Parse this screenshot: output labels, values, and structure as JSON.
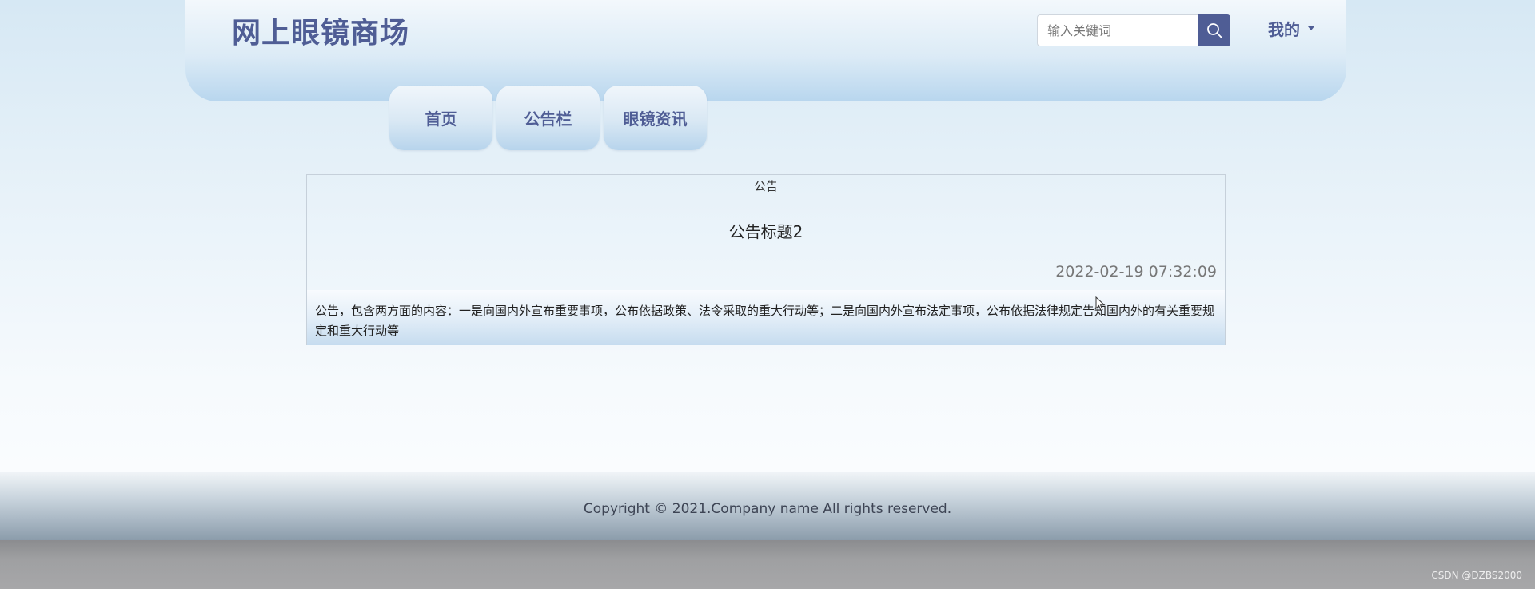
{
  "header": {
    "site_title": "网上眼镜商场",
    "search_placeholder": "输入关键词",
    "user_menu_label": "我的"
  },
  "nav": {
    "tabs": [
      {
        "label": "首页"
      },
      {
        "label": "公告栏"
      },
      {
        "label": "眼镜资讯"
      }
    ]
  },
  "notice": {
    "section_label": "公告",
    "title": "公告标题2",
    "date": "2022-02-19 07:32:09",
    "content": "公告，包含两方面的内容：一是向国内外宣布重要事项，公布依据政策、法令采取的重大行动等；二是向国内外宣布法定事项，公布依据法律规定告知国内外的有关重要规定和重大行动等"
  },
  "footer": {
    "copyright": "Copyright © 2021.Company name All rights reserved."
  },
  "watermark": "CSDN @DZBS2000",
  "colors": {
    "brand": "#4f5d95",
    "header_light": "#f3f8fc",
    "header_dark": "#b8d6ee"
  },
  "icons": {
    "search": "search-icon",
    "menu_caret": "caret-down-icon"
  }
}
